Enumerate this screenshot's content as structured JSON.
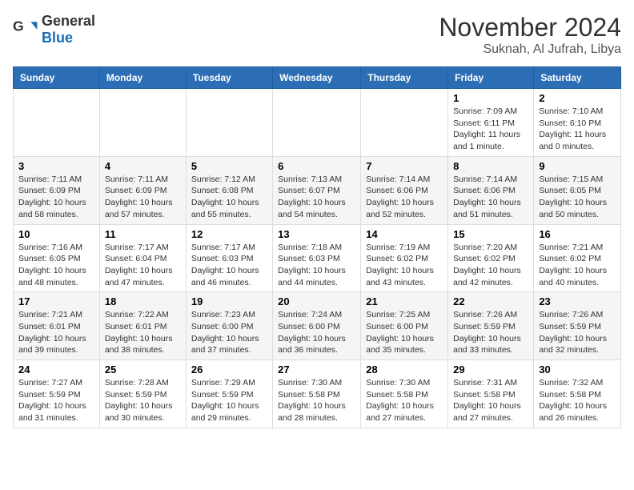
{
  "header": {
    "logo_general": "General",
    "logo_blue": "Blue",
    "month_title": "November 2024",
    "location": "Suknah, Al Jufrah, Libya"
  },
  "days_of_week": [
    "Sunday",
    "Monday",
    "Tuesday",
    "Wednesday",
    "Thursday",
    "Friday",
    "Saturday"
  ],
  "weeks": [
    [
      {
        "day": "",
        "info": ""
      },
      {
        "day": "",
        "info": ""
      },
      {
        "day": "",
        "info": ""
      },
      {
        "day": "",
        "info": ""
      },
      {
        "day": "",
        "info": ""
      },
      {
        "day": "1",
        "info": "Sunrise: 7:09 AM\nSunset: 6:11 PM\nDaylight: 11 hours and 1 minute."
      },
      {
        "day": "2",
        "info": "Sunrise: 7:10 AM\nSunset: 6:10 PM\nDaylight: 11 hours and 0 minutes."
      }
    ],
    [
      {
        "day": "3",
        "info": "Sunrise: 7:11 AM\nSunset: 6:09 PM\nDaylight: 10 hours and 58 minutes."
      },
      {
        "day": "4",
        "info": "Sunrise: 7:11 AM\nSunset: 6:09 PM\nDaylight: 10 hours and 57 minutes."
      },
      {
        "day": "5",
        "info": "Sunrise: 7:12 AM\nSunset: 6:08 PM\nDaylight: 10 hours and 55 minutes."
      },
      {
        "day": "6",
        "info": "Sunrise: 7:13 AM\nSunset: 6:07 PM\nDaylight: 10 hours and 54 minutes."
      },
      {
        "day": "7",
        "info": "Sunrise: 7:14 AM\nSunset: 6:06 PM\nDaylight: 10 hours and 52 minutes."
      },
      {
        "day": "8",
        "info": "Sunrise: 7:14 AM\nSunset: 6:06 PM\nDaylight: 10 hours and 51 minutes."
      },
      {
        "day": "9",
        "info": "Sunrise: 7:15 AM\nSunset: 6:05 PM\nDaylight: 10 hours and 50 minutes."
      }
    ],
    [
      {
        "day": "10",
        "info": "Sunrise: 7:16 AM\nSunset: 6:05 PM\nDaylight: 10 hours and 48 minutes."
      },
      {
        "day": "11",
        "info": "Sunrise: 7:17 AM\nSunset: 6:04 PM\nDaylight: 10 hours and 47 minutes."
      },
      {
        "day": "12",
        "info": "Sunrise: 7:17 AM\nSunset: 6:03 PM\nDaylight: 10 hours and 46 minutes."
      },
      {
        "day": "13",
        "info": "Sunrise: 7:18 AM\nSunset: 6:03 PM\nDaylight: 10 hours and 44 minutes."
      },
      {
        "day": "14",
        "info": "Sunrise: 7:19 AM\nSunset: 6:02 PM\nDaylight: 10 hours and 43 minutes."
      },
      {
        "day": "15",
        "info": "Sunrise: 7:20 AM\nSunset: 6:02 PM\nDaylight: 10 hours and 42 minutes."
      },
      {
        "day": "16",
        "info": "Sunrise: 7:21 AM\nSunset: 6:02 PM\nDaylight: 10 hours and 40 minutes."
      }
    ],
    [
      {
        "day": "17",
        "info": "Sunrise: 7:21 AM\nSunset: 6:01 PM\nDaylight: 10 hours and 39 minutes."
      },
      {
        "day": "18",
        "info": "Sunrise: 7:22 AM\nSunset: 6:01 PM\nDaylight: 10 hours and 38 minutes."
      },
      {
        "day": "19",
        "info": "Sunrise: 7:23 AM\nSunset: 6:00 PM\nDaylight: 10 hours and 37 minutes."
      },
      {
        "day": "20",
        "info": "Sunrise: 7:24 AM\nSunset: 6:00 PM\nDaylight: 10 hours and 36 minutes."
      },
      {
        "day": "21",
        "info": "Sunrise: 7:25 AM\nSunset: 6:00 PM\nDaylight: 10 hours and 35 minutes."
      },
      {
        "day": "22",
        "info": "Sunrise: 7:26 AM\nSunset: 5:59 PM\nDaylight: 10 hours and 33 minutes."
      },
      {
        "day": "23",
        "info": "Sunrise: 7:26 AM\nSunset: 5:59 PM\nDaylight: 10 hours and 32 minutes."
      }
    ],
    [
      {
        "day": "24",
        "info": "Sunrise: 7:27 AM\nSunset: 5:59 PM\nDaylight: 10 hours and 31 minutes."
      },
      {
        "day": "25",
        "info": "Sunrise: 7:28 AM\nSunset: 5:59 PM\nDaylight: 10 hours and 30 minutes."
      },
      {
        "day": "26",
        "info": "Sunrise: 7:29 AM\nSunset: 5:59 PM\nDaylight: 10 hours and 29 minutes."
      },
      {
        "day": "27",
        "info": "Sunrise: 7:30 AM\nSunset: 5:58 PM\nDaylight: 10 hours and 28 minutes."
      },
      {
        "day": "28",
        "info": "Sunrise: 7:30 AM\nSunset: 5:58 PM\nDaylight: 10 hours and 27 minutes."
      },
      {
        "day": "29",
        "info": "Sunrise: 7:31 AM\nSunset: 5:58 PM\nDaylight: 10 hours and 27 minutes."
      },
      {
        "day": "30",
        "info": "Sunrise: 7:32 AM\nSunset: 5:58 PM\nDaylight: 10 hours and 26 minutes."
      }
    ]
  ]
}
